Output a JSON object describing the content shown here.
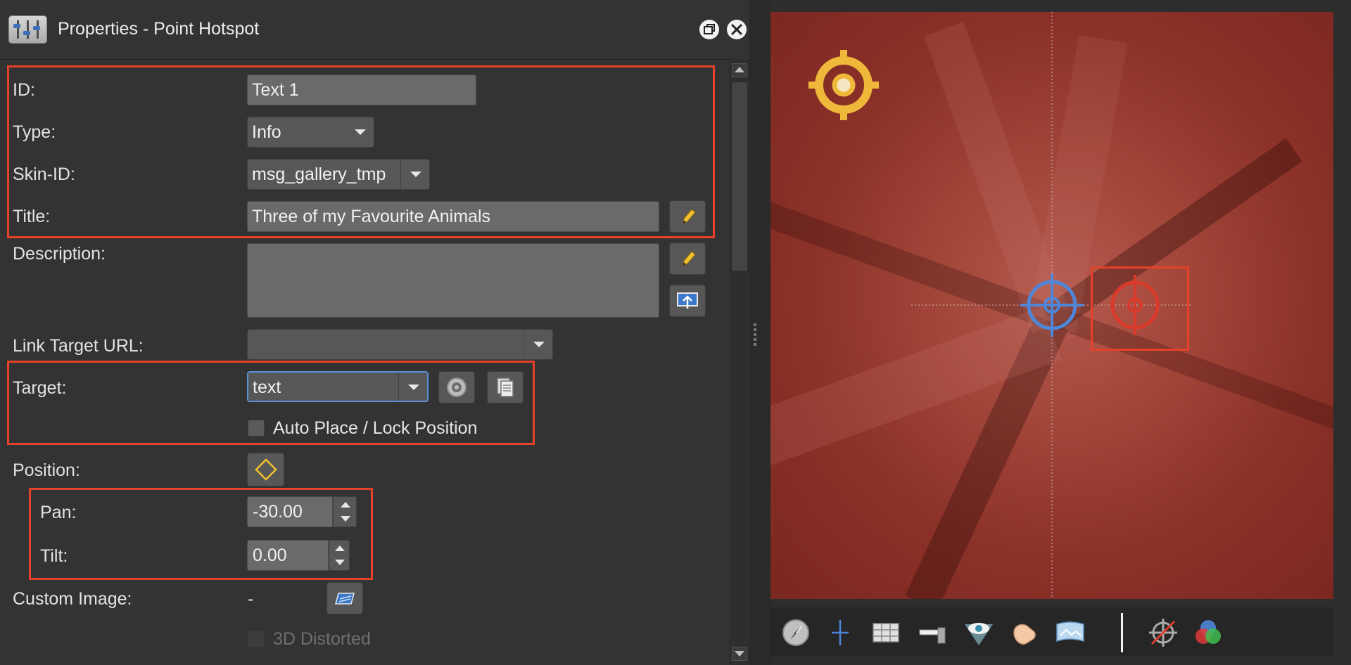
{
  "panel": {
    "title": "Properties - Point Hotspot"
  },
  "form": {
    "id_label": "ID:",
    "id_value": "Text 1",
    "type_label": "Type:",
    "type_value": "Info",
    "skin_label": "Skin-ID:",
    "skin_value": "msg_gallery_tmp",
    "title_label": "Title:",
    "title_value": "Three of my Favourite Animals",
    "description_label": "Description:",
    "link_label": "Link Target URL:",
    "target_label": "Target:",
    "target_value": "text",
    "autoplace_label": "Auto Place / Lock Position",
    "position_label": "Position:",
    "pan_label": "Pan:",
    "pan_value": "-30.00",
    "tilt_label": "Tilt:",
    "tilt_value": "0.00",
    "custom_image_label": "Custom Image:",
    "custom_image_value": "-",
    "distorted_label": "3D Distorted"
  },
  "colors": {
    "highlight_box": "#e6412a",
    "panel_bg": "#333333",
    "field_bg": "#6a6a6a",
    "target_focus": "#5b8fd6",
    "preview_bg": "#a3463a"
  },
  "icons": {
    "app": "settings-sliders-icon",
    "restore": "window-restore-icon",
    "close": "close-icon",
    "edit": "pencil-icon",
    "upload": "upload-icon",
    "target": "target-icon",
    "copy": "copy-icon",
    "keyframe": "diamond-icon",
    "open": "folder-icon",
    "toolbar": [
      "compass-icon",
      "crosshair-icon",
      "grid-icon",
      "bar-icon",
      "eye-icon",
      "hand-icon",
      "panorama-icon",
      "hotspot-off-icon",
      "color-icon"
    ]
  }
}
